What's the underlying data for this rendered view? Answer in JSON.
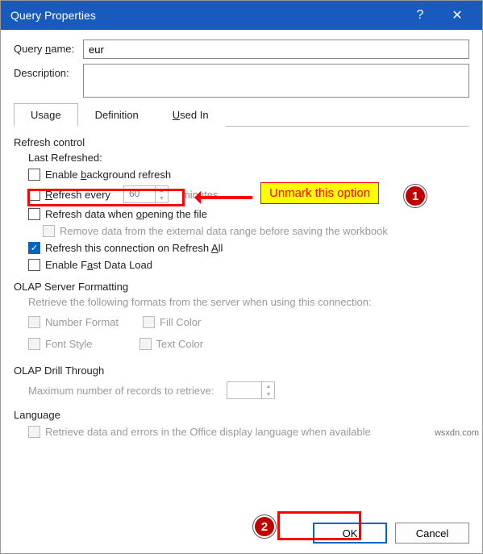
{
  "titlebar": {
    "title": "Query Properties",
    "help": "?",
    "close": "✕"
  },
  "form": {
    "queryname_label_pre": "Query ",
    "queryname_label_u": "n",
    "queryname_label_post": "ame:",
    "queryname_value": "eur",
    "description_label": "Description:",
    "description_value": ""
  },
  "tabs": {
    "usage": "Usage",
    "definition": "Definition",
    "usedin_pre": "",
    "usedin_u": "U",
    "usedin_post": "sed In"
  },
  "refresh": {
    "section": "Refresh control",
    "last_refreshed": "Last Refreshed:",
    "bg_pre": "Enable ",
    "bg_u": "b",
    "bg_post": "ackground refresh",
    "every_u": "R",
    "every_post": "efresh every",
    "every_val": "60",
    "every_unit": "minutes",
    "open_pre": "Refresh data when ",
    "open_u": "o",
    "open_post": "pening the file",
    "remove": "Remove data from the external data range before saving the workbook",
    "all_pre": "Refresh this connection on Refresh ",
    "all_u": "A",
    "all_post": "ll",
    "fast_pre": "Enable F",
    "fast_u": "a",
    "fast_post": "st Data Load"
  },
  "olap_fmt": {
    "section": "OLAP Server Formatting",
    "desc": "Retrieve the following formats from the server when using this connection:",
    "number": "Number Format",
    "fill": "Fill Color",
    "font": "Font Style",
    "text": "Text Color"
  },
  "drill": {
    "section": "OLAP Drill Through",
    "label": "Maximum number of records to retrieve:",
    "value": ""
  },
  "lang": {
    "section": "Language",
    "label": "Retrieve data and errors in the Office display language when available"
  },
  "buttons": {
    "ok": "OK",
    "cancel": "Cancel"
  },
  "anno": {
    "callout": "Unmark this option",
    "b1": "1",
    "b2": "2"
  },
  "watermark": "wsxdn.com"
}
